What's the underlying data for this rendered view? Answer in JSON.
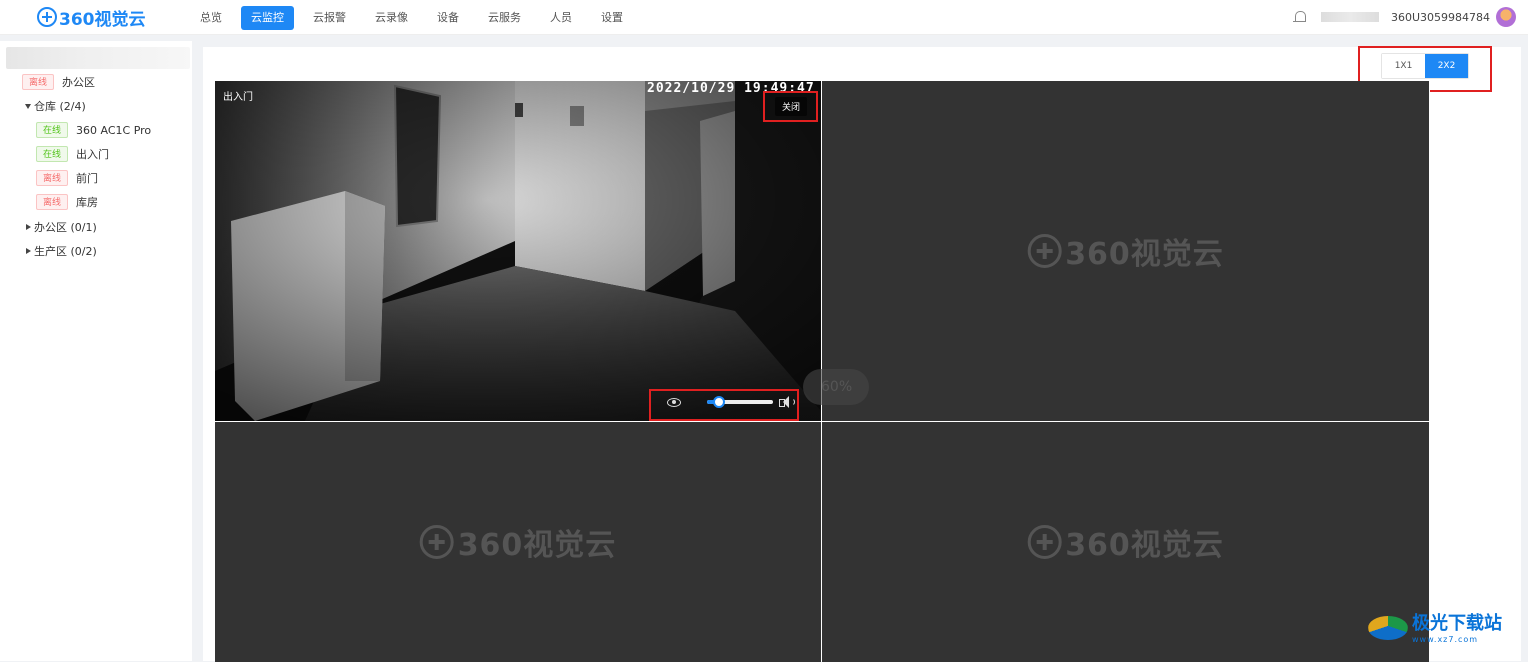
{
  "brand": {
    "logo_text": "360视觉云"
  },
  "nav": {
    "items": [
      "总览",
      "云监控",
      "云报警",
      "云录像",
      "设备",
      "云服务",
      "人员",
      "设置"
    ],
    "active_index": 1
  },
  "user": {
    "account_id": "360U3059984784"
  },
  "sidebar": {
    "nodes": [
      {
        "status": "离线",
        "label": "办公区"
      },
      {
        "label": "仓库 (2/4)",
        "expanded": true
      },
      {
        "status": "在线",
        "label": "360 AC1C Pro"
      },
      {
        "status": "在线",
        "label": "出入门"
      },
      {
        "status": "离线",
        "label": "前门"
      },
      {
        "status": "离线",
        "label": "库房"
      },
      {
        "label": "办公区 (0/1)",
        "expanded": false
      },
      {
        "label": "生产区 (0/2)",
        "expanded": false
      }
    ]
  },
  "layout_switch": {
    "options": [
      "1X1",
      "2X2"
    ],
    "selected": "2X2"
  },
  "player": {
    "camera_name": "出入门",
    "timestamp": "2022/10/29  19:49:47",
    "close_label": "关闭",
    "volume": 0.18,
    "zoom_label": "60%"
  },
  "placeholder": {
    "watermark": "360视觉云"
  },
  "site_watermark": {
    "title": "极光下载站",
    "subtitle": "www.xz7.com"
  },
  "colors": {
    "accent": "#1e88f5",
    "offline": "#f56c6c",
    "online": "#52c41a",
    "highlight": "#e02020"
  }
}
